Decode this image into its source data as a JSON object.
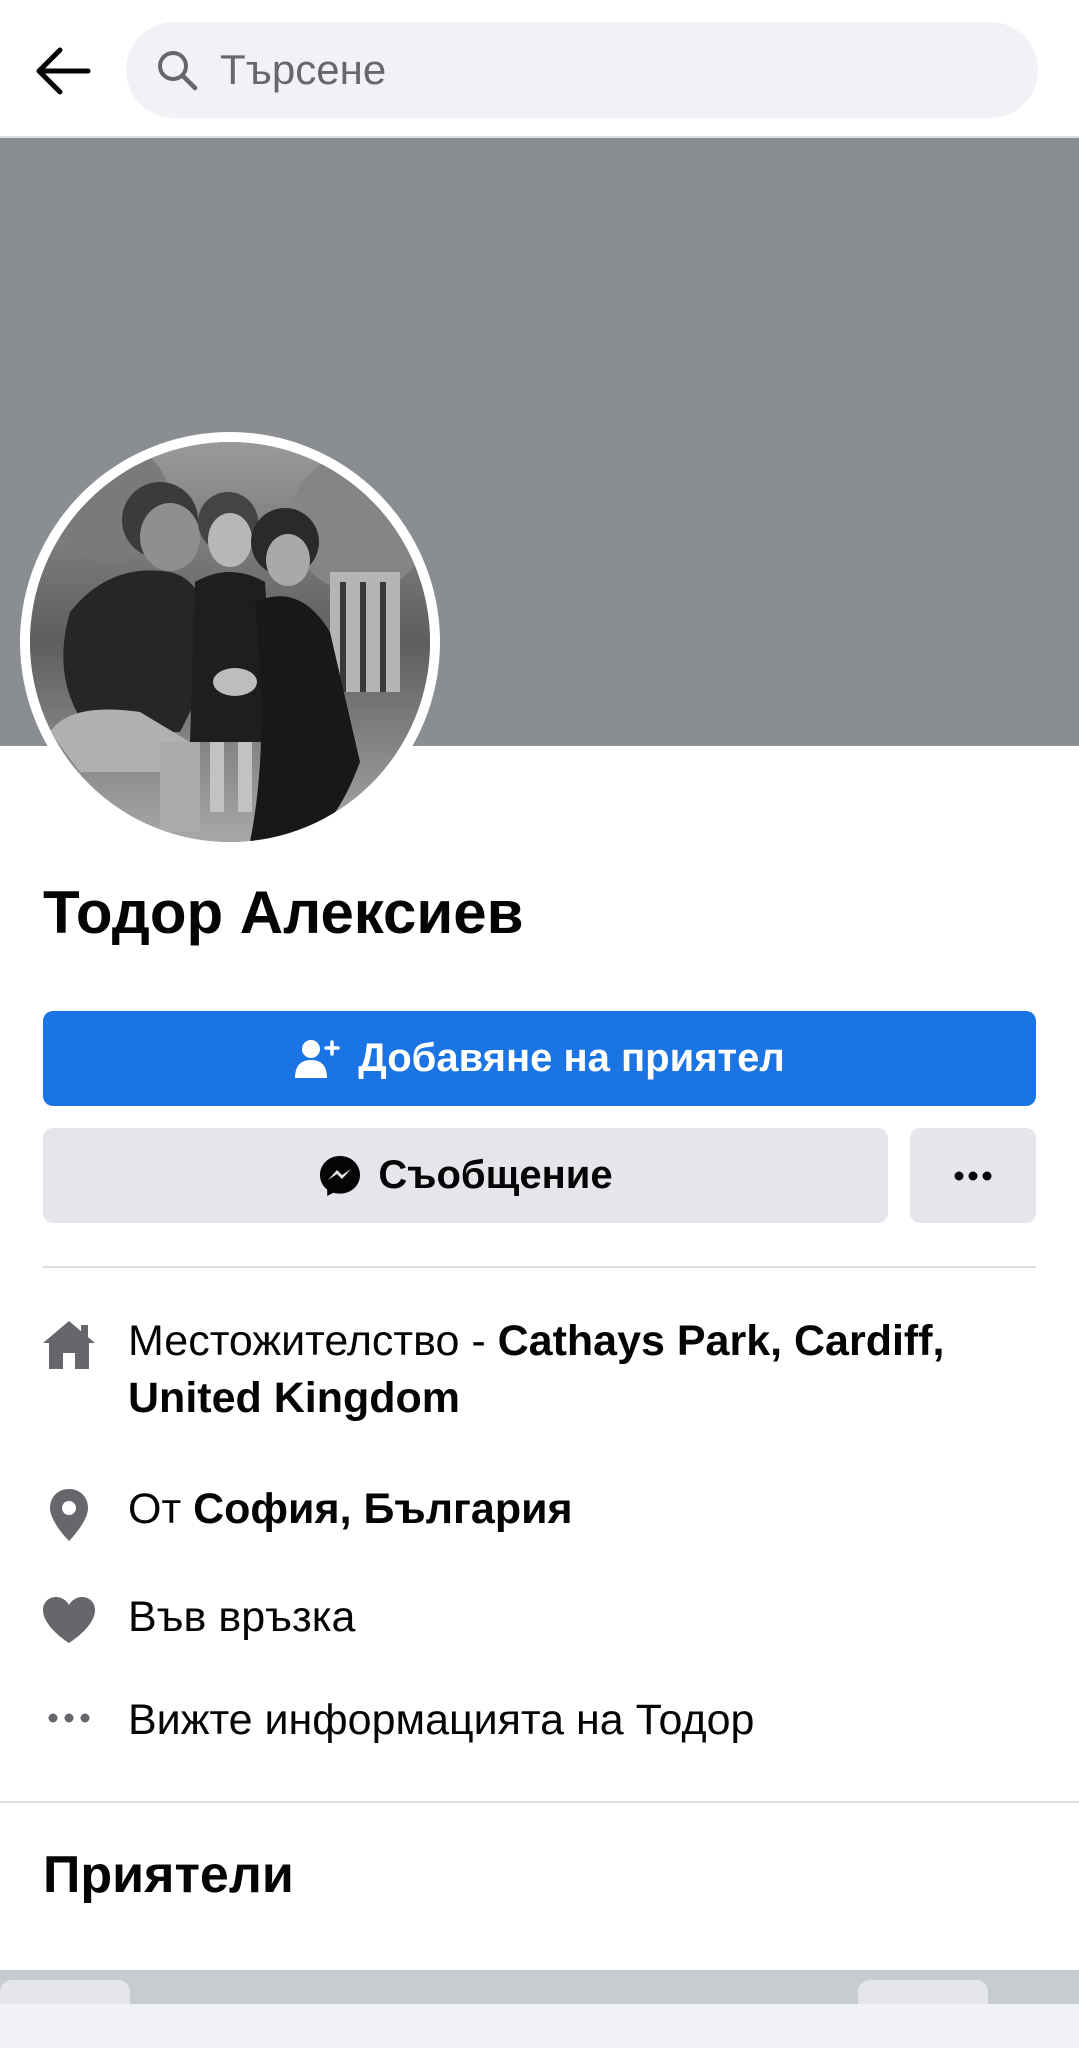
{
  "search": {
    "placeholder": "Търсене"
  },
  "profile": {
    "name": "Тодор Алексиев",
    "add_friend_label": "Добавяне на приятел",
    "message_label": "Съобщение",
    "more_label": "···"
  },
  "intro": {
    "residence_prefix": "Местожителство - ",
    "residence_value": "Cathays Park, Cardiff, United Kingdom",
    "from_prefix": "От ",
    "from_value": "София, България",
    "relationship": "Във връзка",
    "see_info": "Вижте информацията на Тодор"
  },
  "friends": {
    "title": "Приятели"
  },
  "colors": {
    "primary": "#1b74e4",
    "cover": "#8a8d91",
    "secondary_button": "#e4e6eb",
    "icon_gray": "#65676b"
  }
}
